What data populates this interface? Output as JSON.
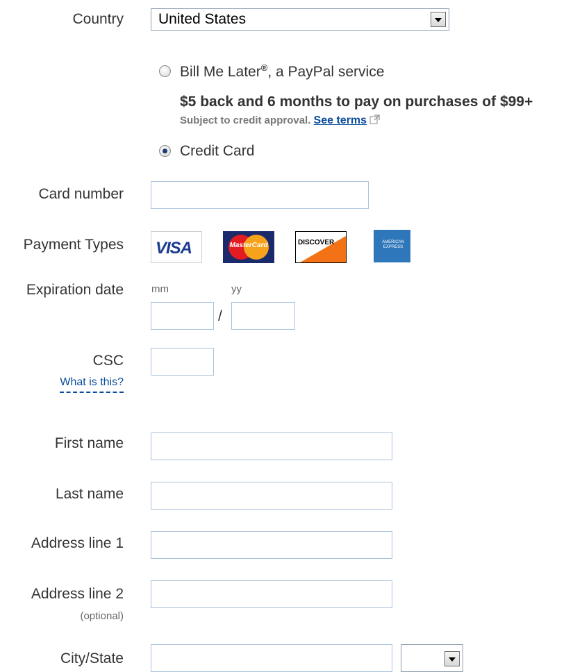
{
  "country": {
    "label": "Country",
    "value": "United States"
  },
  "payment_method": {
    "bill_me_later": {
      "label_pre": "Bill Me Later",
      "mark": "®",
      "label_post": ", a PayPal service",
      "promo": "$5 back and 6 months to pay on purchases of $99+",
      "subject_text": "Subject to credit approval.",
      "terms_link": "See terms",
      "selected": false
    },
    "credit_card": {
      "label": "Credit Card",
      "selected": true
    }
  },
  "card_number": {
    "label": "Card number",
    "value": ""
  },
  "payment_types": {
    "label": "Payment Types",
    "cards": [
      {
        "name": "visa",
        "text": "VISA",
        "color": "#1a1f71"
      },
      {
        "name": "mastercard",
        "text": "MasterCard",
        "color": "#eb001b"
      },
      {
        "name": "discover",
        "text": "DISCOVER",
        "color": "#f47216"
      },
      {
        "name": "amex",
        "text": "AMERICAN EXPRESS",
        "color": "#2e77bb"
      }
    ]
  },
  "expiration": {
    "label": "Expiration date",
    "mm_hint": "mm",
    "yy_hint": "yy",
    "separator": "/"
  },
  "csc": {
    "label": "CSC",
    "help_link": "What is this?"
  },
  "first_name": {
    "label": "First name"
  },
  "last_name": {
    "label": "Last name"
  },
  "address1": {
    "label": "Address line 1"
  },
  "address2": {
    "label": "Address line 2",
    "note": "(optional)"
  },
  "city_state": {
    "label": "City/State",
    "state_value": ""
  }
}
